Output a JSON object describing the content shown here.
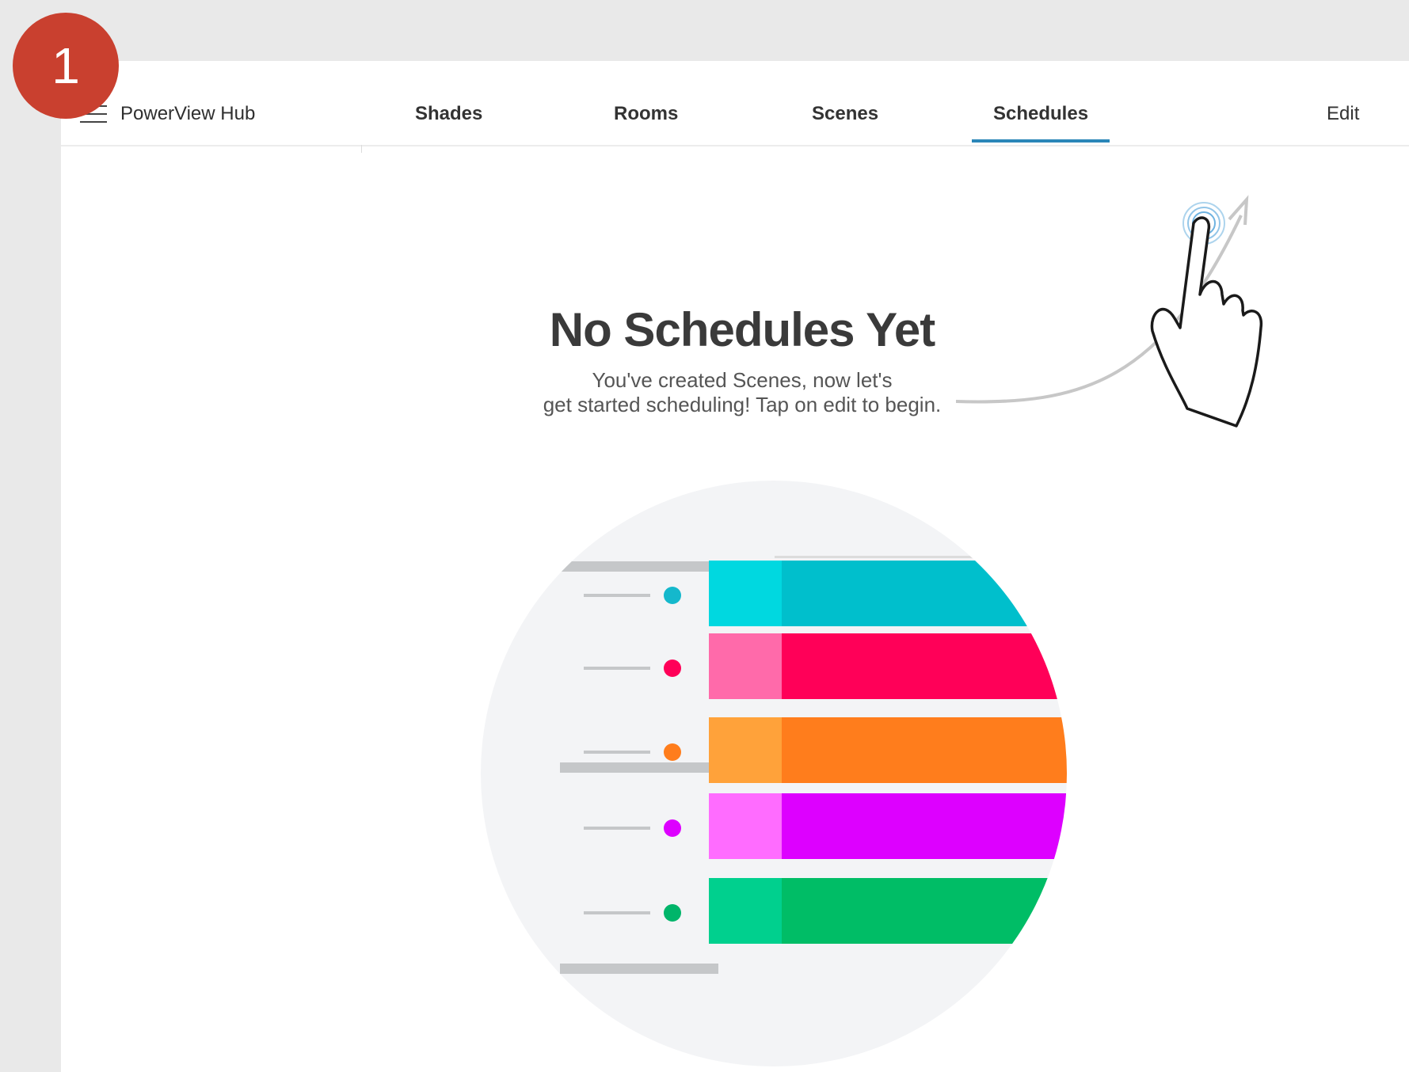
{
  "step_badge": "1",
  "navbar": {
    "app_title": "PowerView Hub",
    "tabs": [
      {
        "label": "Shades"
      },
      {
        "label": "Rooms"
      },
      {
        "label": "Scenes"
      },
      {
        "label": "Schedules",
        "active": true
      }
    ],
    "edit_label": "Edit"
  },
  "empty_state": {
    "title": "No Schedules Yet",
    "subtitle_line1": "You've created Scenes, now let's",
    "subtitle_line2": "get started scheduling! Tap on edit to begin."
  },
  "colors": {
    "badge": "#c9402f",
    "active_tab_underline": "#2a86b8",
    "illustration_background": "#f3f4f6",
    "rows": [
      {
        "light": "#00d8e0",
        "dark": "#00bfcc",
        "dot": "#14b8cc"
      },
      {
        "light": "#ff6aaa",
        "dark": "#ff0058",
        "dot": "#ff0058"
      },
      {
        "light": "#ffa23a",
        "dark": "#ff7d1c",
        "dot": "#ff7d1c"
      },
      {
        "light": "#ff6cff",
        "dark": "#dd00ff",
        "dot": "#dd00ff"
      },
      {
        "light": "#00d08e",
        "dark": "#00bd66",
        "dot": "#00b56a"
      }
    ]
  },
  "icons": [
    "menu-icon",
    "tap-gesture-hand-icon",
    "arrow-icon"
  ]
}
